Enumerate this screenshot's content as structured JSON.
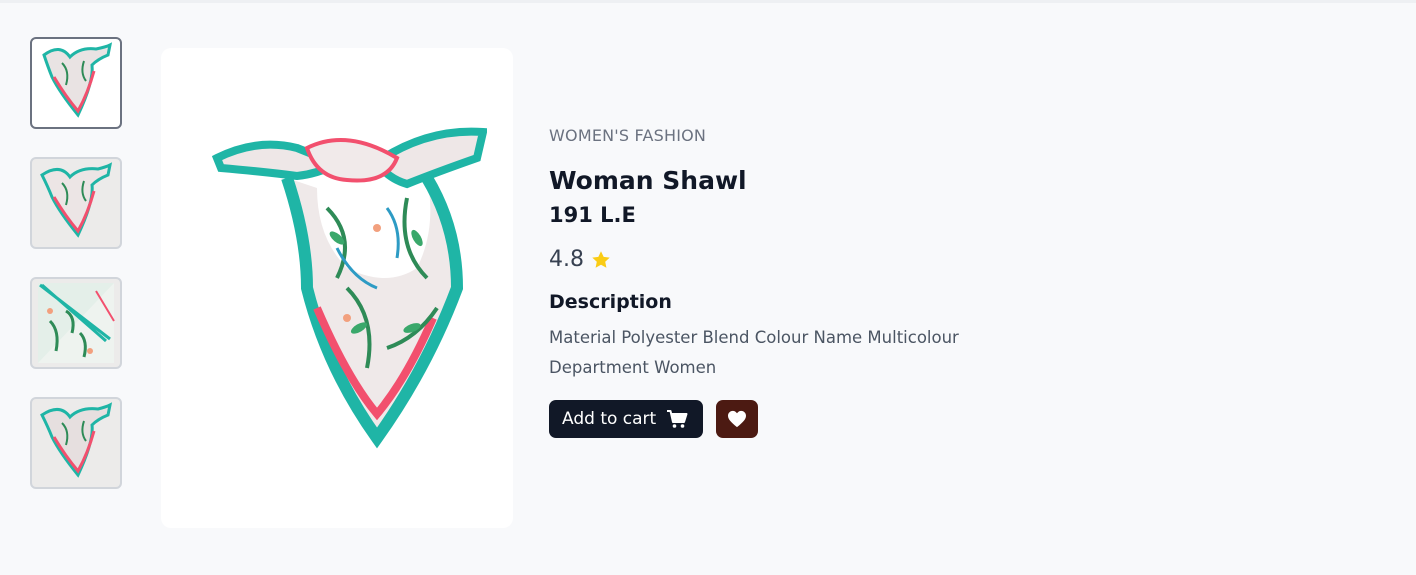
{
  "product": {
    "category": "WOMEN'S FASHION",
    "title": "Woman Shawl",
    "price": "191 L.E",
    "rating": "4.8",
    "description_heading": "Description",
    "description": "Material Polyester Blend Colour Name Multicolour Department Women"
  },
  "actions": {
    "add_to_cart_label": "Add to cart",
    "cart_icon": "shopping-cart-icon",
    "wishlist_icon": "heart-icon"
  },
  "thumbnails": [
    "shawl-knotted-front",
    "shawl-knotted-alt",
    "shawl-flat-corner",
    "shawl-knotted-back"
  ],
  "colors": {
    "accent_dark": "#111827",
    "wishlist": "#4c1a12",
    "star": "#facc15",
    "teal": "#1fb5a6",
    "pink": "#f2506e",
    "leaf": "#2e8b57"
  }
}
